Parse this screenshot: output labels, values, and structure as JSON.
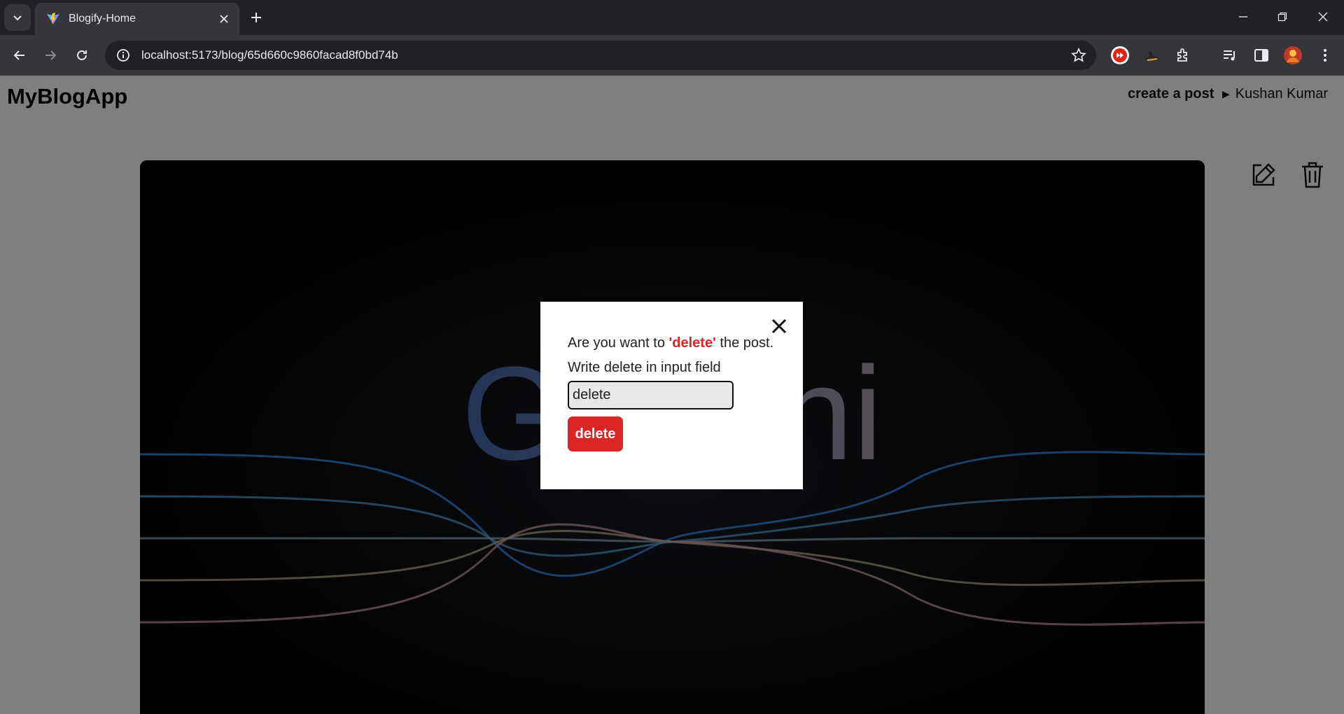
{
  "browser": {
    "tab_title": "Blogify-Home",
    "url": "localhost:5173/blog/65d660c9860facad8f0bd74b"
  },
  "header": {
    "brand": "MyBlogApp",
    "create_post_label": "create a post",
    "user_menu_label": "Kushan Kumar"
  },
  "post": {
    "hero_icon": "gemini-hero-image",
    "edit_icon": "edit-icon",
    "delete_icon": "trash-icon"
  },
  "modal": {
    "question_prefix": "Are you want to ",
    "question_keyword": "'delete'",
    "question_suffix": " the post.",
    "instruction": "Write delete in input field",
    "input_value": "delete",
    "delete_button_label": "delete",
    "keyword_color": "#dc2626"
  }
}
